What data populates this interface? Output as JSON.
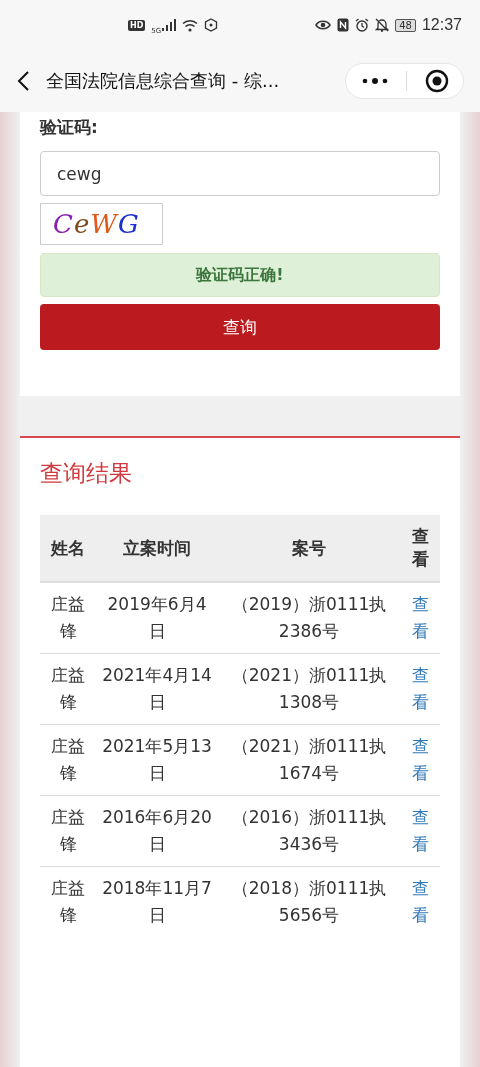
{
  "status_bar": {
    "hd": "HD",
    "time": "12:37",
    "battery": "48",
    "network": "5G"
  },
  "nav": {
    "title": "全国法院信息综合查询 - 综..."
  },
  "form": {
    "captcha_label": "验证码:",
    "captcha_value": "cewg",
    "captcha_image_text": "CeWG",
    "alert": "验证码正确!",
    "submit": "查询"
  },
  "results": {
    "title": "查询结果",
    "columns": [
      "姓名",
      "立案时间",
      "案号",
      "查看"
    ],
    "rows": [
      {
        "name": "庄益锋",
        "date": "2019年6月4日",
        "case_no": "（2019）浙0111执2386号",
        "link": "查看"
      },
      {
        "name": "庄益锋",
        "date": "2021年4月14日",
        "case_no": "（2021）浙0111执1308号",
        "link": "查看"
      },
      {
        "name": "庄益锋",
        "date": "2021年5月13日",
        "case_no": "（2021）浙0111执1674号",
        "link": "查看"
      },
      {
        "name": "庄益锋",
        "date": "2016年6月20日",
        "case_no": "（2016）浙0111执3436号",
        "link": "查看"
      },
      {
        "name": "庄益锋",
        "date": "2018年11月7日",
        "case_no": "（2018）浙0111执5656号",
        "link": "查看"
      }
    ]
  }
}
